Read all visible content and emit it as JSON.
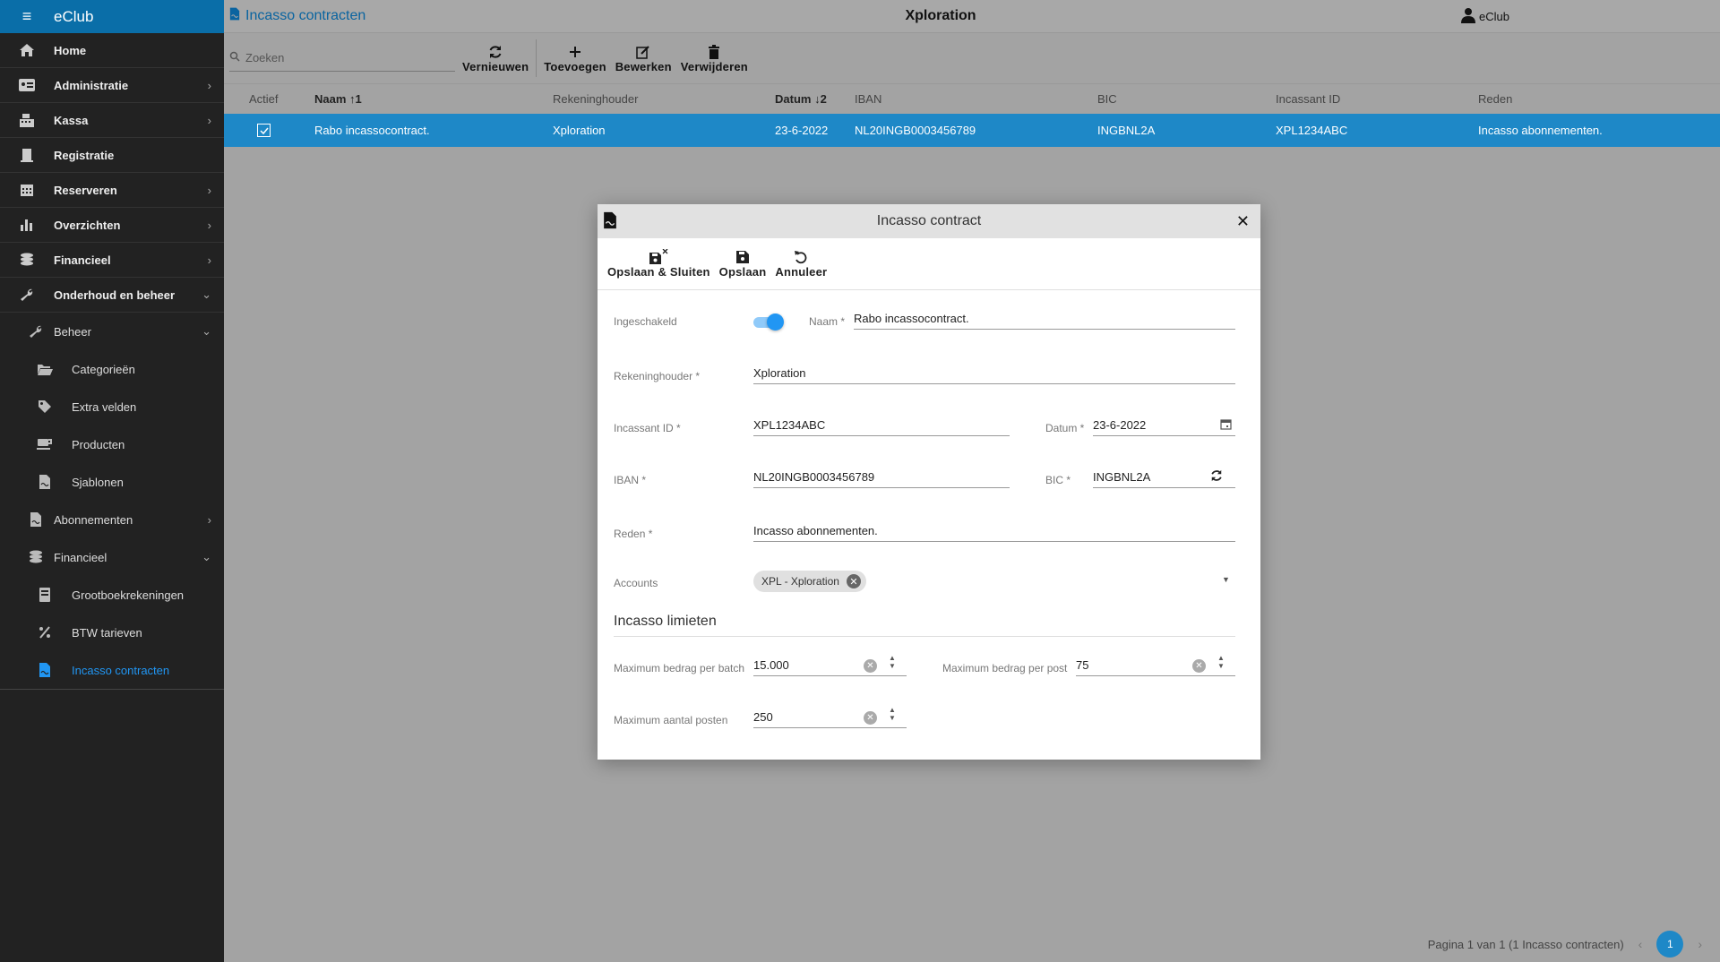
{
  "sidebar": {
    "brand": "eClub",
    "items": [
      {
        "label": "Home"
      },
      {
        "label": "Administratie"
      },
      {
        "label": "Kassa"
      },
      {
        "label": "Registratie"
      },
      {
        "label": "Reserveren"
      },
      {
        "label": "Overzichten"
      },
      {
        "label": "Financieel"
      },
      {
        "label": "Onderhoud en beheer"
      }
    ],
    "beheer": "Beheer",
    "beheer_items": [
      {
        "label": "Categorieën"
      },
      {
        "label": "Extra velden"
      },
      {
        "label": "Producten"
      },
      {
        "label": "Sjablonen"
      }
    ],
    "abonnementen": "Abonnementen",
    "financieel_sub": "Financieel",
    "financieel_items": [
      {
        "label": "Grootboekrekeningen"
      },
      {
        "label": "BTW tarieven"
      },
      {
        "label": "Incasso contracten"
      }
    ]
  },
  "header": {
    "title": "Incasso contracten",
    "center": "Xploration",
    "user": "eClub"
  },
  "toolbar": {
    "search_placeholder": "Zoeken",
    "refresh": "Vernieuwen",
    "add": "Toevoegen",
    "edit": "Bewerken",
    "delete": "Verwijderen"
  },
  "grid": {
    "columns": {
      "actief": "Actief",
      "naam": "Naam",
      "naam_sort": "↑1",
      "rekeninghouder": "Rekeninghouder",
      "datum": "Datum",
      "datum_sort": "↓2",
      "iban": "IBAN",
      "bic": "BIC",
      "incassant": "Incassant ID",
      "reden": "Reden"
    },
    "row": {
      "naam": "Rabo incassocontract.",
      "rekeninghouder": "Xploration",
      "datum": "23-6-2022",
      "iban": "NL20INGB0003456789",
      "bic": "INGBNL2A",
      "incassant": "XPL1234ABC",
      "reden": "Incasso abonnementen."
    }
  },
  "pager": {
    "text": "Pagina 1 van 1 (1 Incasso contracten)",
    "page": "1"
  },
  "dialog": {
    "title": "Incasso contract",
    "save_close": "Opslaan & Sluiten",
    "save": "Opslaan",
    "cancel": "Annuleer",
    "labels": {
      "ingeschakeld": "Ingeschakeld",
      "naam": "Naam *",
      "rekeninghouder": "Rekeninghouder *",
      "incassant": "Incassant ID *",
      "datum": "Datum *",
      "iban": "IBAN *",
      "bic": "BIC *",
      "reden": "Reden *",
      "accounts": "Accounts",
      "max_batch": "Maximum bedrag per batch",
      "max_post": "Maximum bedrag per post",
      "max_posten": "Maximum aantal posten"
    },
    "values": {
      "enabled": true,
      "naam": "Rabo incassocontract.",
      "rekeninghouder": "Xploration",
      "incassant": "XPL1234ABC",
      "datum": "23-6-2022",
      "iban": "NL20INGB0003456789",
      "bic": "INGBNL2A",
      "reden": "Incasso abonnementen.",
      "account_chip": "XPL - Xploration",
      "max_batch": "15.000",
      "max_post": "75",
      "max_posten": "250"
    },
    "section": "Incasso limieten"
  },
  "colors": {
    "accent": "#1e88c7",
    "sidebar_bg": "#222222",
    "brand_bg": "#0a6ea8"
  }
}
